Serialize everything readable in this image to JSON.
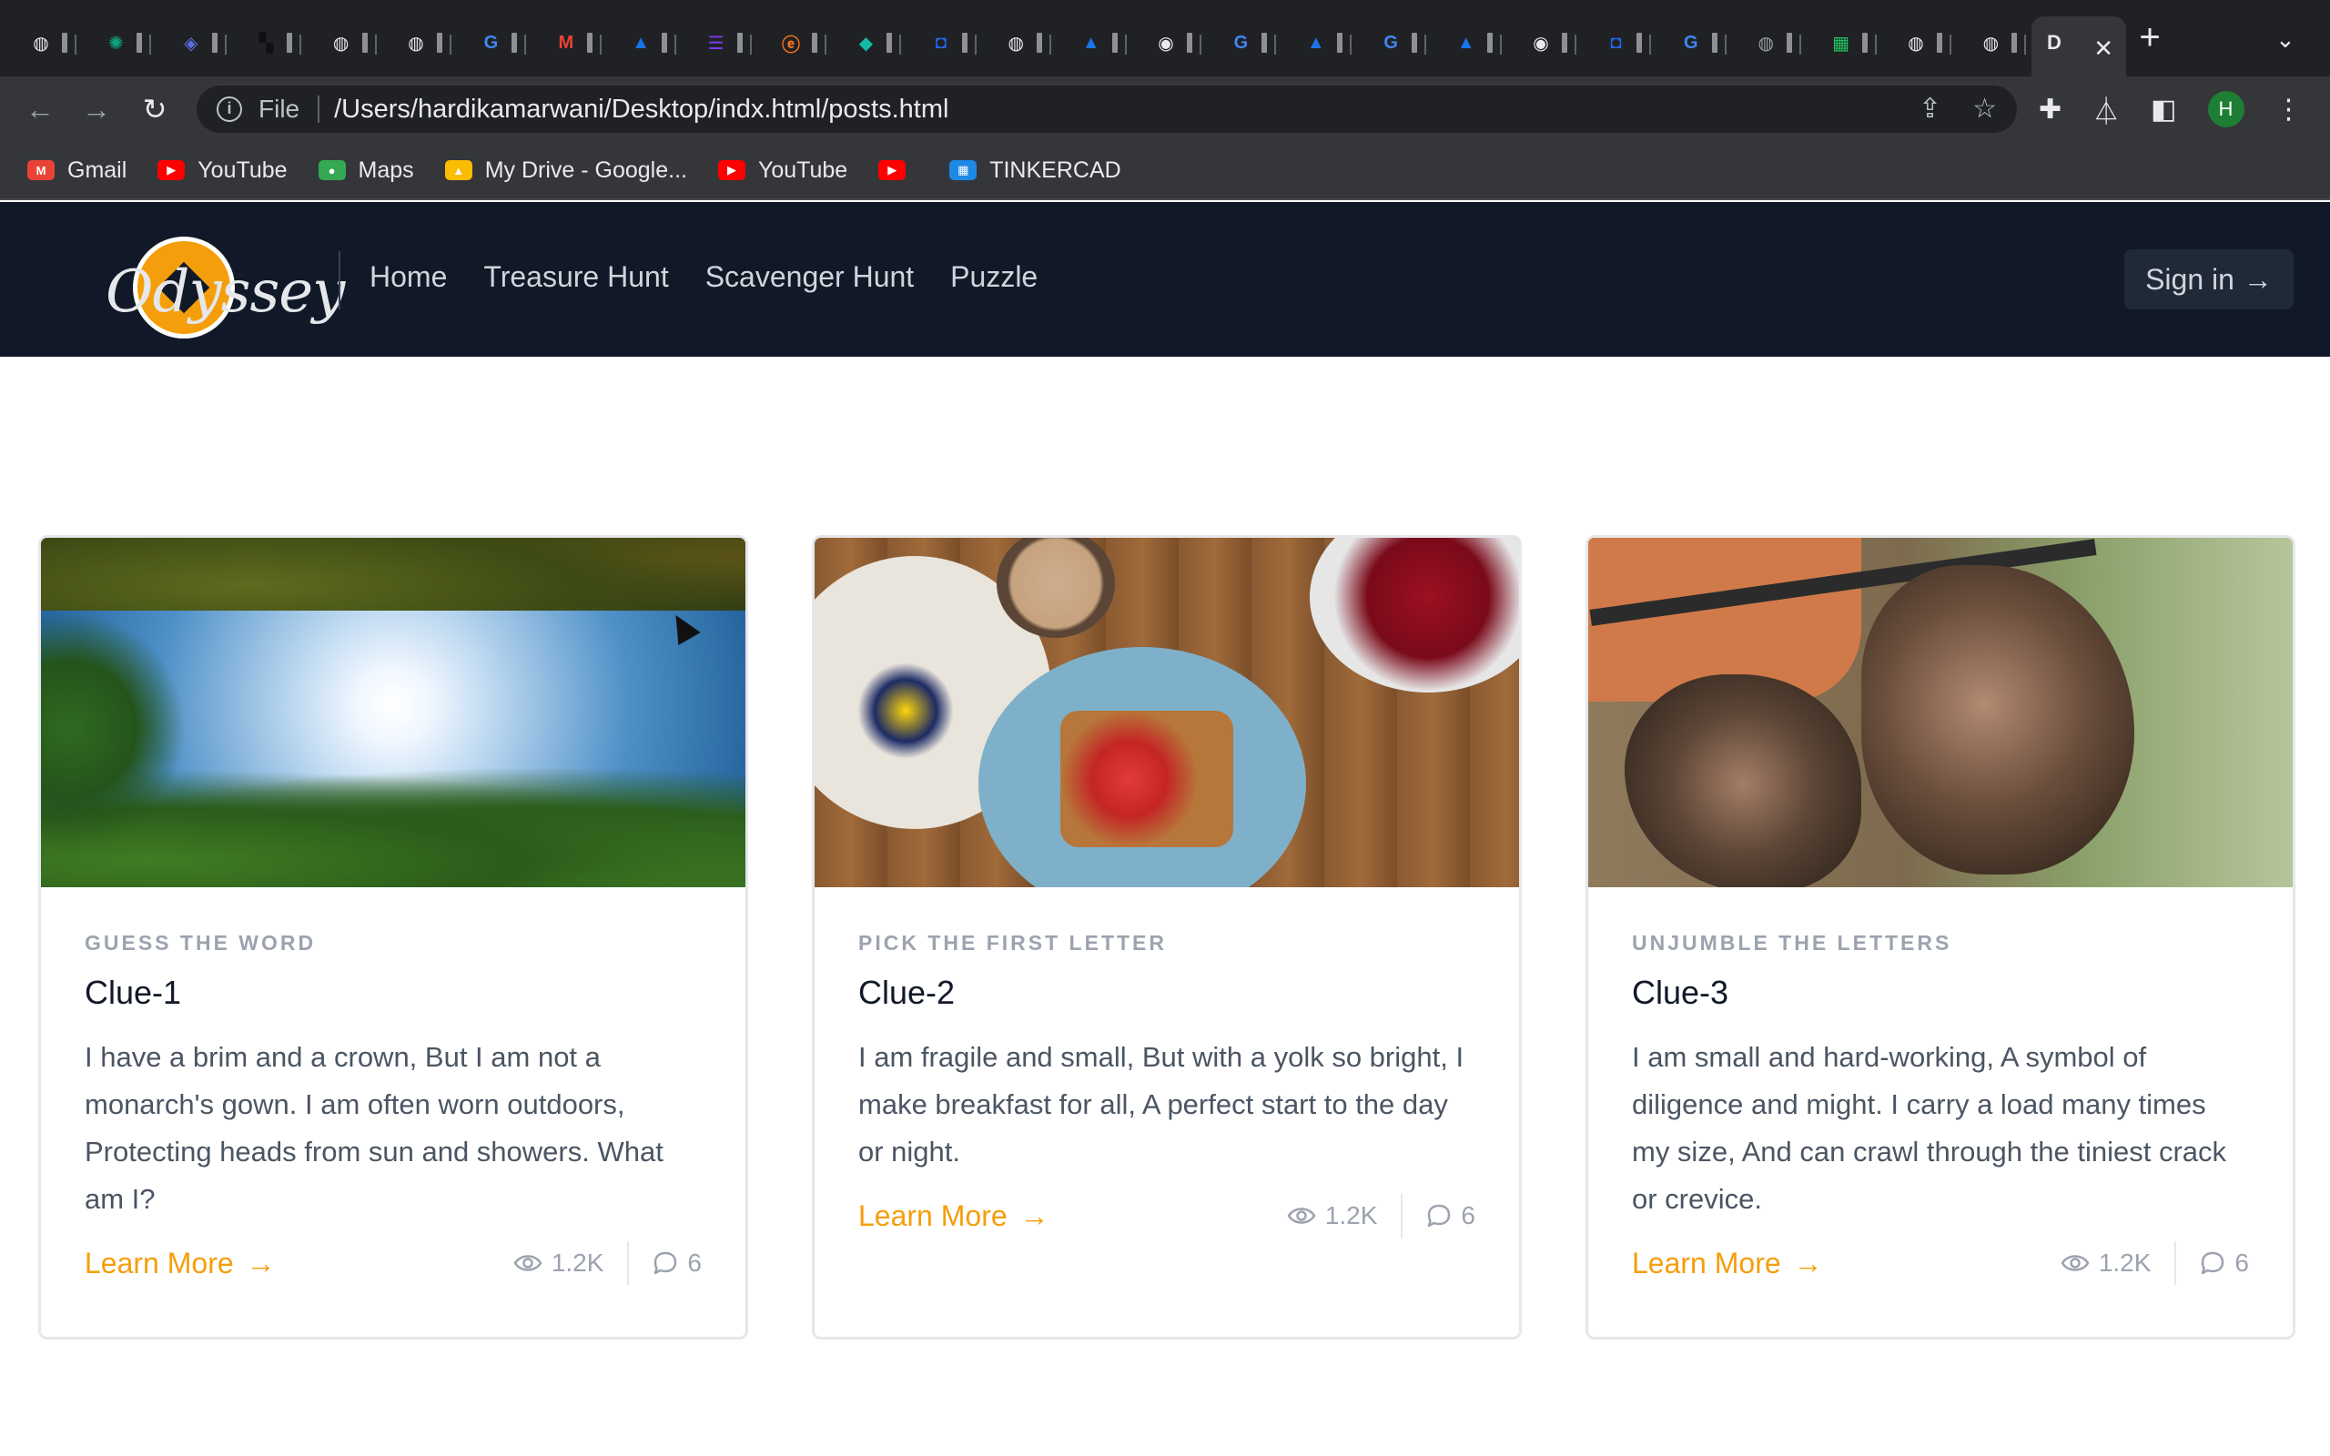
{
  "browser": {
    "tabs": [
      {
        "icon": "globe-icon",
        "glyph": "◍",
        "color": "#e8eaed"
      },
      {
        "icon": "openai-icon",
        "glyph": "✺",
        "color": "#10a37f"
      },
      {
        "icon": "layers-icon",
        "glyph": "◈",
        "color": "#5b6ee1"
      },
      {
        "icon": "pixel-icon",
        "glyph": "▚",
        "color": "#111111"
      },
      {
        "icon": "globe-icon",
        "glyph": "◍",
        "color": "#e8eaed"
      },
      {
        "icon": "globe-icon",
        "glyph": "◍",
        "color": "#e8eaed"
      },
      {
        "icon": "google-icon",
        "glyph": "G",
        "color": "#4285f4"
      },
      {
        "icon": "gmail-icon",
        "glyph": "M",
        "color": "#ea4335"
      },
      {
        "icon": "triangle-icon",
        "glyph": "▲",
        "color": "#1a73e8"
      },
      {
        "icon": "list-icon",
        "glyph": "☰",
        "color": "#7c3aed"
      },
      {
        "icon": "swirl-icon",
        "glyph": "ⓔ",
        "color": "#f97316"
      },
      {
        "icon": "diamond-icon",
        "glyph": "◆",
        "color": "#14b8a6"
      },
      {
        "icon": "bucket-icon",
        "glyph": "◘",
        "color": "#2563eb"
      },
      {
        "icon": "globe-icon",
        "glyph": "◍",
        "color": "#e8eaed"
      },
      {
        "icon": "triangle-icon",
        "glyph": "▲",
        "color": "#1a73e8"
      },
      {
        "icon": "chrome-icon",
        "glyph": "◉",
        "color": "#e8eaed"
      },
      {
        "icon": "google-icon",
        "glyph": "G",
        "color": "#4285f4"
      },
      {
        "icon": "triangle-icon",
        "glyph": "▲",
        "color": "#1a73e8"
      },
      {
        "icon": "google-icon",
        "glyph": "G",
        "color": "#4285f4"
      },
      {
        "icon": "triangle-icon",
        "glyph": "▲",
        "color": "#1a73e8"
      },
      {
        "icon": "chrome-icon",
        "glyph": "◉",
        "color": "#e8eaed"
      },
      {
        "icon": "bucket-icon",
        "glyph": "◘",
        "color": "#2563eb"
      },
      {
        "icon": "google-icon",
        "glyph": "G",
        "color": "#4285f4"
      },
      {
        "icon": "globe-icon",
        "glyph": "◍",
        "color": "#9aa0a6"
      },
      {
        "icon": "sheet-icon",
        "glyph": "▦",
        "color": "#22c55e"
      },
      {
        "icon": "globe-icon",
        "glyph": "◍",
        "color": "#e8eaed"
      },
      {
        "icon": "globe-icon",
        "glyph": "◍",
        "color": "#e8eaed"
      }
    ],
    "active_tab": {
      "title_fragment": "D",
      "close_glyph": "✕"
    },
    "new_tab_glyph": "+",
    "tab_menu_glyph": "⌄",
    "nav": {
      "back": "←",
      "forward": "→",
      "reload": "↻"
    },
    "address": {
      "info_glyph": "i",
      "scheme": "File",
      "url": "/Users/hardikamarwani/Desktop/indx.html/posts.html"
    },
    "omnibox_icons": {
      "share": "⇪",
      "star": "☆"
    },
    "toolbar_icons": {
      "extensions": "✚",
      "labs": "⏃",
      "sidepanel": "◧",
      "avatar": "H",
      "menu": "⋮"
    },
    "bookmarks": [
      {
        "label": "Gmail",
        "icon": "gmail-icon",
        "badge": "M",
        "color": "#ea4335"
      },
      {
        "label": "YouTube",
        "icon": "youtube-icon",
        "badge": "▶",
        "color": "#ff0000"
      },
      {
        "label": "Maps",
        "icon": "maps-icon",
        "badge": "●",
        "color": "#34a853"
      },
      {
        "label": "My Drive - Google...",
        "icon": "drive-icon",
        "badge": "▲",
        "color": "#fbbc04"
      },
      {
        "label": "YouTube",
        "icon": "youtube-icon",
        "badge": "▶",
        "color": "#ff0000"
      },
      {
        "label": "",
        "icon": "youtube-icon",
        "badge": "▶",
        "color": "#ff0000"
      },
      {
        "label": "TINKERCAD",
        "icon": "tinkercad-icon",
        "badge": "▦",
        "color": "#1e88e5"
      }
    ]
  },
  "site": {
    "logo_text": "Odyssey",
    "nav": [
      "Home",
      "Treasure Hunt",
      "Scavenger Hunt",
      "Puzzle"
    ],
    "signin_label": "Sign in",
    "arrow": "→"
  },
  "cards": [
    {
      "category": "GUESS THE WORD",
      "title": "Clue-1",
      "text": "I have a brim and a crown, But I am not a monarch's gown. I am often worn outdoors, Protecting heads from sun and showers. What am I?",
      "cta": "Learn More",
      "views": "1.2K",
      "comments": "6",
      "image": "sky-through-trees"
    },
    {
      "category": "PICK THE FIRST LETTER",
      "title": "Clue-2",
      "text": "I am fragile and small, But with a yolk so bright, I make breakfast for all, A perfect start to the day or night.",
      "cta": "Learn More",
      "views": "1.2K",
      "comments": "6",
      "image": "breakfast-table"
    },
    {
      "category": "UNJUMBLE THE LETTERS",
      "title": "Clue-3",
      "text": "I am small and hard-working, A symbol of diligence and might. I carry a load many times my size, And can crawl through the tiniest crack or crevice.",
      "cta": "Learn More",
      "views": "1.2K",
      "comments": "6",
      "image": "muddy-hands"
    }
  ],
  "colors": {
    "accent": "#f59e0b",
    "header_bg": "#111827",
    "chrome_bg": "#202124"
  }
}
